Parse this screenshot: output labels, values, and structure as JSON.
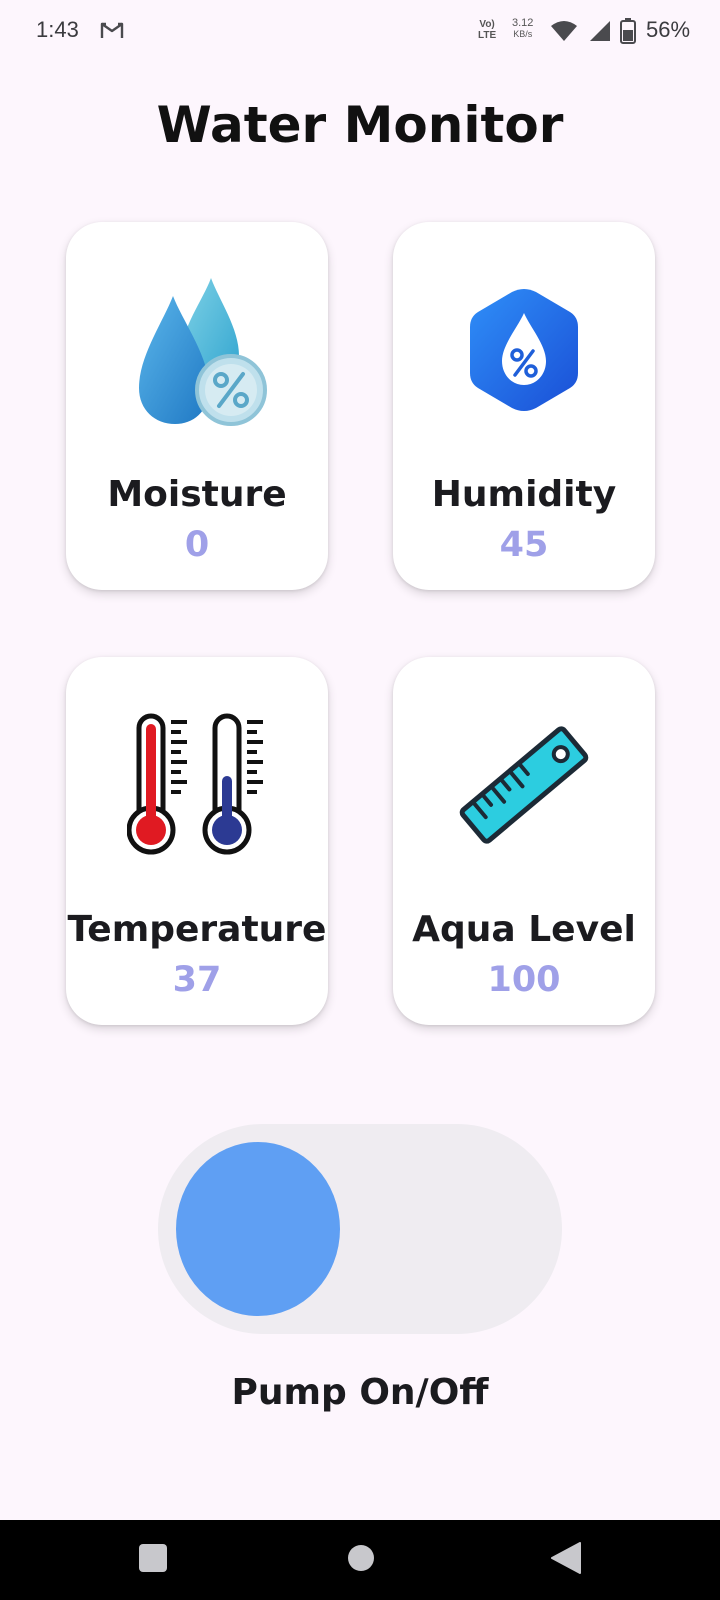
{
  "status_bar": {
    "time": "1:43",
    "network_volte_top": "Vo)",
    "network_volte_bottom": "LTE",
    "net_speed_value": "3.12",
    "net_speed_unit": "KB/s",
    "battery_percent": "56%",
    "icons": [
      "gmail-icon",
      "wifi-icon",
      "signal-icon",
      "battery-icon"
    ]
  },
  "page": {
    "title": "Water Monitor"
  },
  "cards": {
    "moisture": {
      "label": "Moisture",
      "value": "0",
      "icon": "water-drops-percent-icon"
    },
    "humidity": {
      "label": "Humidity",
      "value": "45",
      "icon": "humidity-hexagon-icon"
    },
    "temperature": {
      "label": "Temperature",
      "value": "37",
      "icon": "thermometers-icon"
    },
    "aqua_level": {
      "label": "Aqua Level",
      "value": "100",
      "icon": "ruler-icon"
    }
  },
  "pump": {
    "label": "Pump On/Off",
    "state": "off"
  },
  "nav_bar": {
    "buttons": [
      "recents-icon",
      "home-icon",
      "back-icon"
    ]
  },
  "colors": {
    "background": "#fdf6fd",
    "value_text": "#9fa0e8",
    "switch_track": "#efecf1",
    "switch_thumb": "#5f9ff3"
  }
}
